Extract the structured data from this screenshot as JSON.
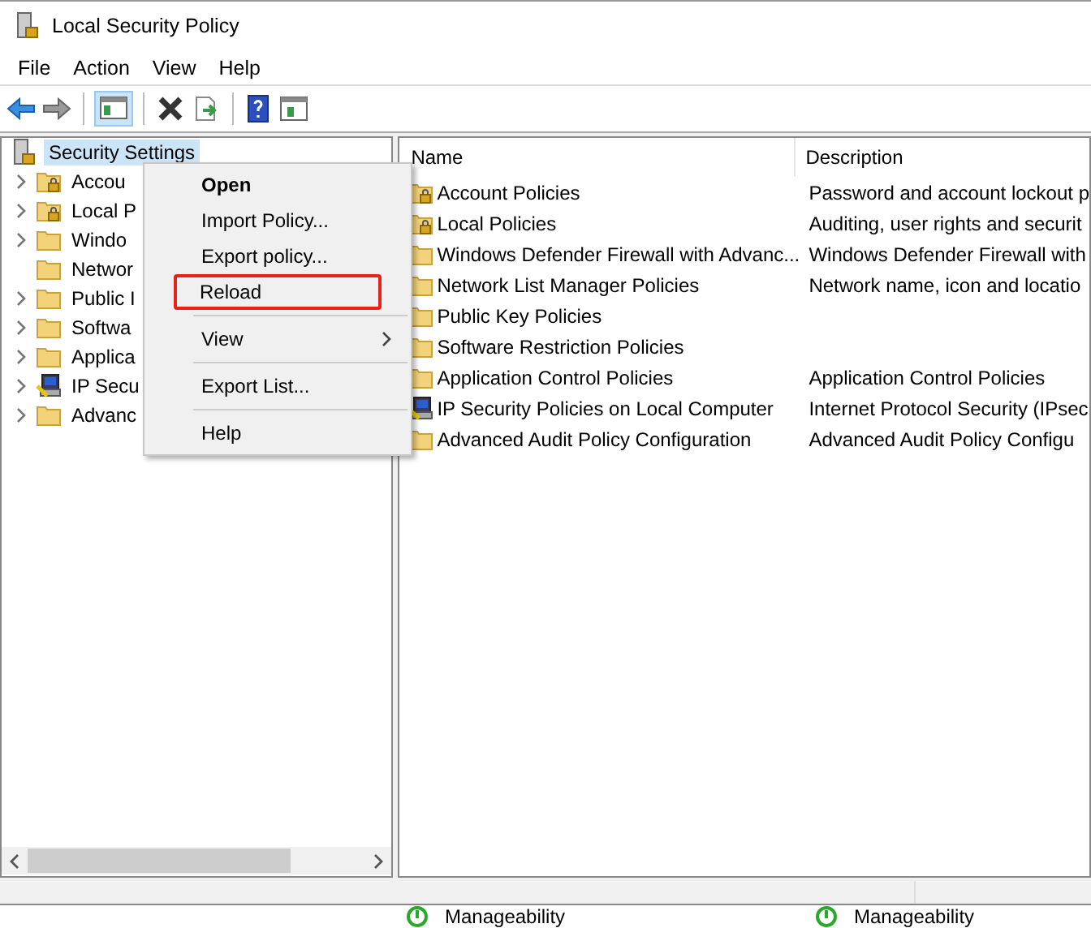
{
  "window": {
    "title": "Local Security Policy"
  },
  "menu": [
    "File",
    "Action",
    "View",
    "Help"
  ],
  "tree": {
    "root": {
      "label": "Security Settings",
      "selected": true
    },
    "items": [
      {
        "label": "Accou",
        "kind": "locked",
        "has_children": true
      },
      {
        "label": "Local P",
        "kind": "locked",
        "has_children": true
      },
      {
        "label": "Windo",
        "kind": "folder",
        "has_children": true
      },
      {
        "label": "Networ",
        "kind": "folder",
        "has_children": false
      },
      {
        "label": "Public I",
        "kind": "folder",
        "has_children": true
      },
      {
        "label": "Softwa",
        "kind": "folder",
        "has_children": true
      },
      {
        "label": "Applica",
        "kind": "folder",
        "has_children": true
      },
      {
        "label": "IP Secu",
        "kind": "ipsec",
        "has_children": true
      },
      {
        "label": "Advanc",
        "kind": "folder",
        "has_children": true
      }
    ]
  },
  "context_menu": [
    {
      "kind": "item",
      "label": "Open",
      "default": true,
      "annotated": false
    },
    {
      "kind": "item",
      "label": "Import Policy...",
      "default": false,
      "annotated": false
    },
    {
      "kind": "item",
      "label": "Export policy...",
      "default": false,
      "annotated": false
    },
    {
      "kind": "item",
      "label": "Reload",
      "default": false,
      "annotated": true
    },
    {
      "kind": "separator"
    },
    {
      "kind": "submenu",
      "label": "View",
      "default": false,
      "annotated": false
    },
    {
      "kind": "separator"
    },
    {
      "kind": "item",
      "label": "Export List...",
      "default": false,
      "annotated": false
    },
    {
      "kind": "separator"
    },
    {
      "kind": "item",
      "label": "Help",
      "default": false,
      "annotated": false
    }
  ],
  "table": {
    "columns": [
      "Name",
      "Description"
    ],
    "rows": [
      {
        "kind": "locked",
        "name": "Account Policies",
        "description": "Password and account lockout p"
      },
      {
        "kind": "locked",
        "name": "Local Policies",
        "description": "Auditing, user rights and securit"
      },
      {
        "kind": "folder",
        "name": "Windows Defender Firewall with Advanc...",
        "description": "Windows Defender Firewall with"
      },
      {
        "kind": "folder",
        "name": "Network List Manager Policies",
        "description": "Network name, icon and locatio"
      },
      {
        "kind": "folder",
        "name": "Public Key Policies"
      },
      {
        "kind": "folder",
        "name": "Software Restriction Policies"
      },
      {
        "kind": "folder",
        "name": "Application Control Policies",
        "description": "Application Control Policies"
      },
      {
        "kind": "ipsec",
        "name": "IP Security Policies on Local Computer",
        "description": "Internet Protocol Security (IPsec"
      },
      {
        "kind": "folder",
        "name": "Advanced Audit Policy Configuration",
        "description": "Advanced Audit Policy Configu"
      }
    ]
  },
  "background_window": {
    "items": [
      "Manageability",
      "Manageability"
    ]
  }
}
